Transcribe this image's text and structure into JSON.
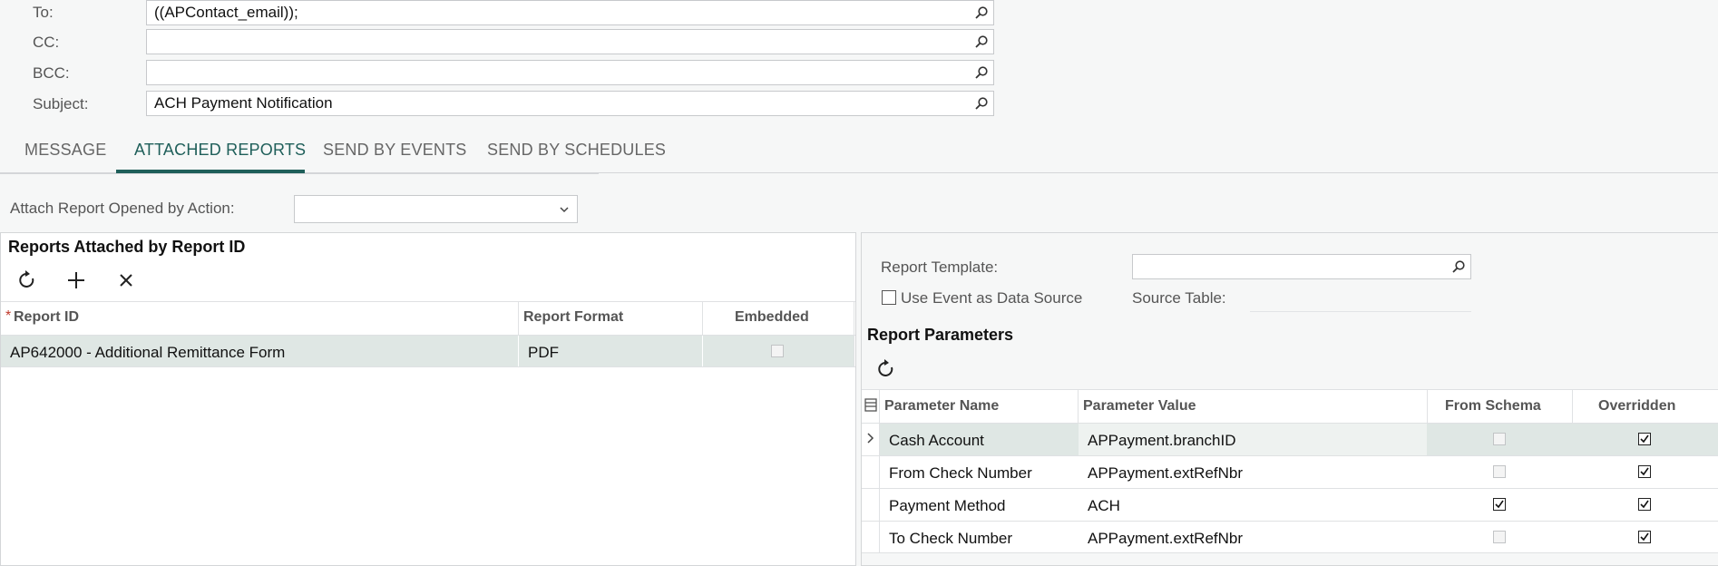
{
  "email": {
    "to_label": "To:",
    "to_value": "((APContact_email));",
    "cc_label": "CC:",
    "cc_value": "",
    "bcc_label": "BCC:",
    "bcc_value": "",
    "subject_label": "Subject:",
    "subject_value": "ACH Payment Notification"
  },
  "tabs": [
    {
      "label": "MESSAGE",
      "active": false
    },
    {
      "label": "ATTACHED REPORTS",
      "active": true
    },
    {
      "label": "SEND BY EVENTS",
      "active": false
    },
    {
      "label": "SEND BY SCHEDULES",
      "active": false
    }
  ],
  "attach": {
    "label": "Attach Report Opened by Action:",
    "value": ""
  },
  "reports_panel": {
    "title": "Reports Attached by Report ID",
    "columns": {
      "required_mark": "*",
      "report_id": "Report ID",
      "report_format": "Report Format",
      "embedded": "Embedded"
    },
    "rows": [
      {
        "report_id": "AP642000 - Additional Remittance Form",
        "report_format": "PDF",
        "embedded": false
      }
    ]
  },
  "template_panel": {
    "template_label": "Report Template:",
    "template_value": "",
    "use_event_label": "Use Event as Data Source",
    "use_event_checked": false,
    "source_table_label": "Source Table:",
    "params_title": "Report Parameters",
    "columns": {
      "name": "Parameter Name",
      "value": "Parameter Value",
      "from_schema": "From Schema",
      "overridden": "Overridden"
    },
    "rows": [
      {
        "name": "Cash Account",
        "value": "APPayment.branchID",
        "from_schema": false,
        "overridden": true
      },
      {
        "name": "From Check Number",
        "value": "APPayment.extRefNbr",
        "from_schema": false,
        "overridden": true
      },
      {
        "name": "Payment Method",
        "value": "ACH",
        "from_schema": true,
        "overridden": true
      },
      {
        "name": "To Check Number",
        "value": "APPayment.extRefNbr",
        "from_schema": false,
        "overridden": true
      }
    ]
  },
  "colors": {
    "accent": "#1f5f5a",
    "selected_row": "#dfe7e4",
    "border": "#c7c9cc"
  }
}
